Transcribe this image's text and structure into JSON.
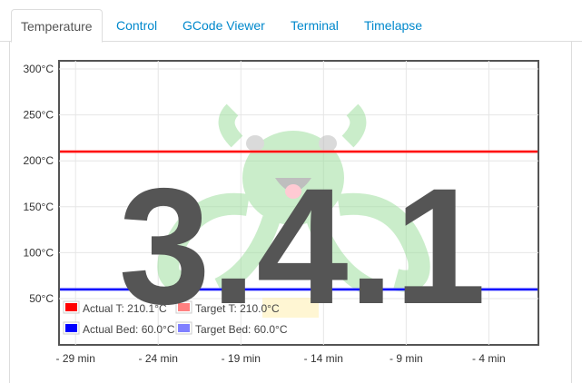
{
  "tabs": [
    {
      "label": "Temperature",
      "active": true
    },
    {
      "label": "Control",
      "active": false
    },
    {
      "label": "GCode Viewer",
      "active": false
    },
    {
      "label": "Terminal",
      "active": false
    },
    {
      "label": "Timelapse",
      "active": false
    }
  ],
  "overlay": {
    "version": "3.4.1"
  },
  "colors": {
    "accent": "#0088cc",
    "actual_t": "#ff0000",
    "target_t": "#ff8080",
    "actual_bed": "#0000ff",
    "target_bed": "#8080ff",
    "logo": "#7ed47e"
  },
  "chart_data": {
    "type": "line",
    "ylim": [
      0,
      310
    ],
    "yticks": [
      "50°C",
      "100°C",
      "150°C",
      "200°C",
      "250°C",
      "300°C"
    ],
    "ytick_values": [
      50,
      100,
      150,
      200,
      250,
      300
    ],
    "xticks": [
      "- 29 min",
      "- 24 min",
      "- 19 min",
      "- 14 min",
      "- 9 min",
      "- 4 min"
    ],
    "xtick_values": [
      -29,
      -24,
      -19,
      -14,
      -9,
      -4
    ],
    "xlim": [
      -30,
      -1
    ],
    "grid": true,
    "legend_position": "bottom-left",
    "series": [
      {
        "name": "Actual T: 210.1°C",
        "color": "#ff0000",
        "value": 210.1
      },
      {
        "name": "Target T: 210.0°C",
        "color": "#ff8080",
        "value": 210.0
      },
      {
        "name": "Actual Bed: 60.0°C",
        "color": "#0000ff",
        "value": 60.0
      },
      {
        "name": "Target Bed: 60.0°C",
        "color": "#8080ff",
        "value": 60.0
      }
    ]
  }
}
